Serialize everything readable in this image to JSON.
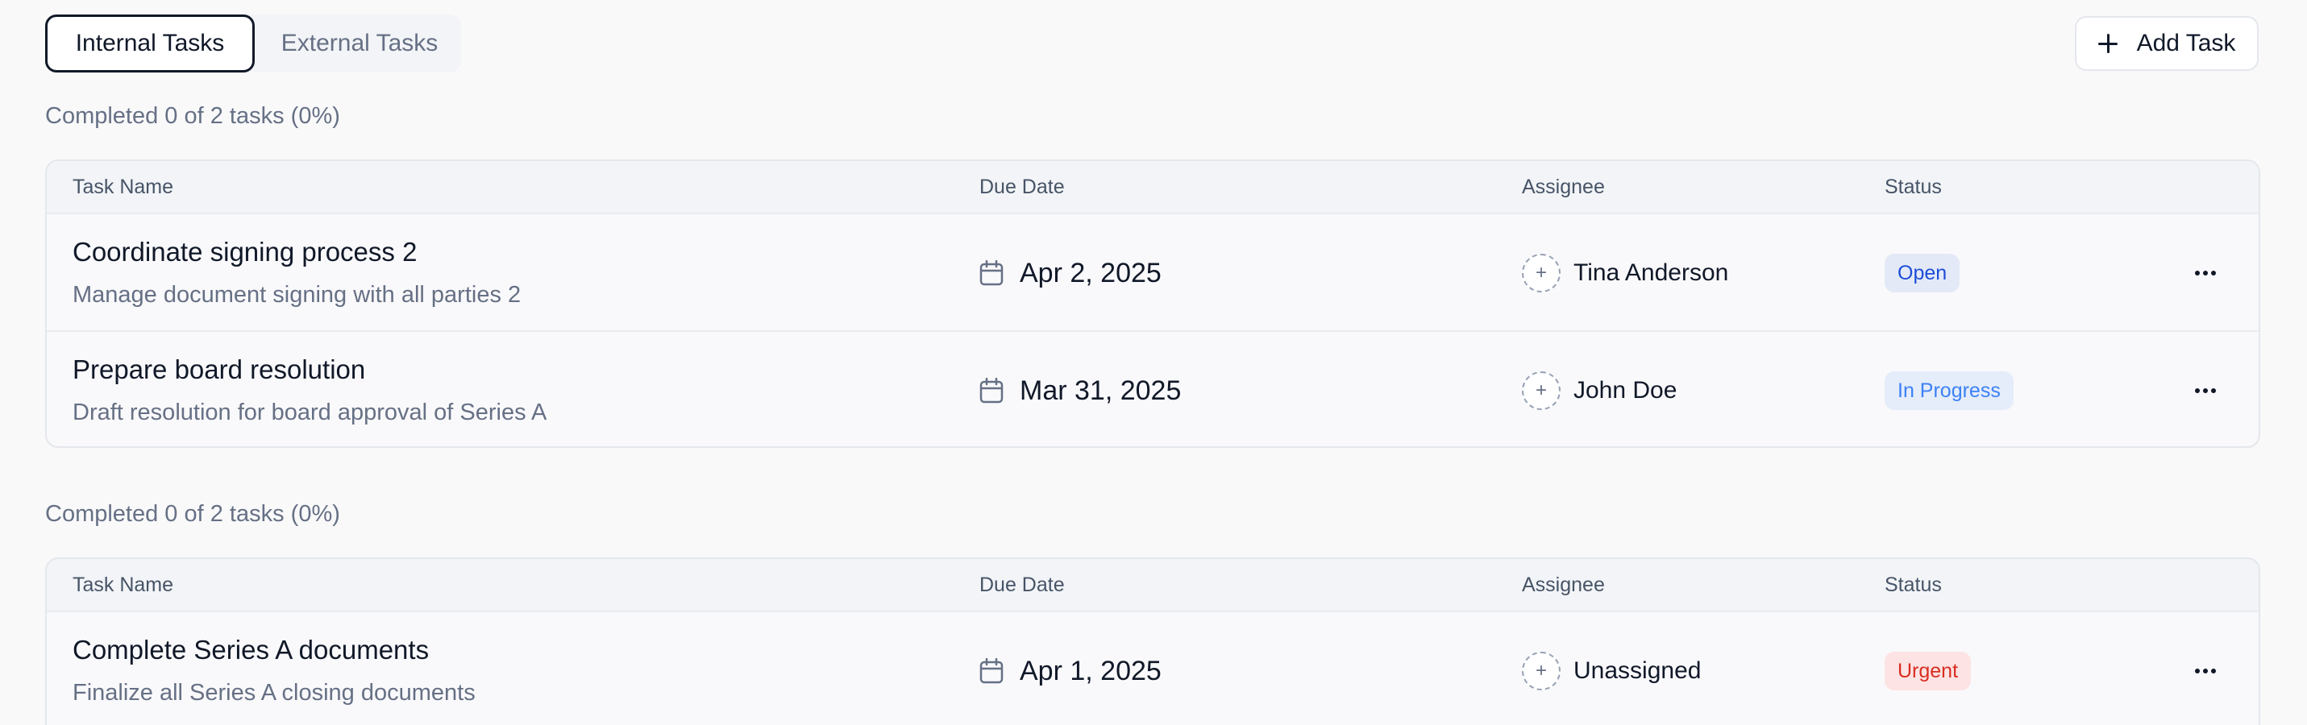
{
  "tabs": [
    {
      "label": "Internal Tasks",
      "active": true
    },
    {
      "label": "External Tasks",
      "active": false
    }
  ],
  "add_task_label": "Add Task",
  "columns": {
    "name": "Task Name",
    "due": "Due Date",
    "assignee": "Assignee",
    "status": "Status"
  },
  "sections": [
    {
      "summary": "Completed 0 of 2 tasks (0%)",
      "tasks": [
        {
          "title": "Coordinate signing process 2",
          "description": "Manage document signing with all parties 2",
          "due": "Apr 2, 2025",
          "assignee": "Tina Anderson",
          "status": "Open"
        },
        {
          "title": "Prepare board resolution",
          "description": "Draft resolution for board approval of Series A",
          "due": "Mar 31, 2025",
          "assignee": "John Doe",
          "status": "In Progress"
        }
      ]
    },
    {
      "summary": "Completed 0 of 2 tasks (0%)",
      "tasks": [
        {
          "title": "Complete Series A documents",
          "description": "Finalize all Series A closing documents",
          "due": "Apr 1, 2025",
          "assignee": "Unassigned",
          "status": "Urgent"
        }
      ]
    }
  ],
  "status_colors": {
    "Open": "#1d4ed8",
    "In Progress": "#3b82f6",
    "Urgent": "#d92d20"
  },
  "icons": {
    "add": "plus-icon",
    "due": "calendar-icon",
    "assignee": "add-person-icon",
    "row_menu": "more-horizontal-icon"
  }
}
